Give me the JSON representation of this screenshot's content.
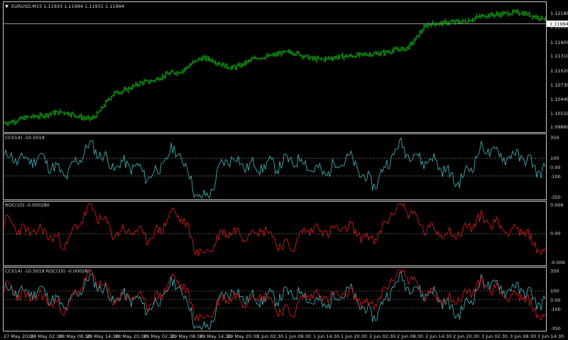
{
  "window": {
    "symbol_header": "EURUSD,M15  1.11933 1.11994 1.11931 1.11994",
    "dropdown_glyph": "▼"
  },
  "colors": {
    "background": "#000000",
    "frame": "#c8c8c8",
    "price_bars": "#16c616",
    "cci_line": "#3fa9b0",
    "roc_line": "#d11a1a",
    "level_line": "#9a9a9a",
    "price_tag_bg": "#ffffff"
  },
  "panes": {
    "price": {
      "current_price_label": "1.11994",
      "y_ticks": [
        "1.12180",
        "1.11890",
        "1.11600",
        "1.11310",
        "1.11020",
        "1.10730",
        "1.10440",
        "1.10150",
        "1.09860"
      ]
    },
    "cci": {
      "label": "CCI(14) -10.5019",
      "y_ticks": [
        "350",
        "100",
        "0.00",
        "-100",
        "-350"
      ]
    },
    "roc": {
      "label": "ROC(10) -0.000280",
      "y_ticks": [
        "0.006",
        "0.00",
        "-0.006"
      ]
    },
    "combo": {
      "label": "CCI(14) -10.5019  ROC(10) -0.000280",
      "y_ticks": [
        "350",
        "100",
        "0.00",
        "-100",
        "-350"
      ]
    }
  },
  "time_axis": [
    "27 May 2020",
    "28 May 02:30",
    "28 May 08:30",
    "28 May 14:30",
    "28 May 20:30",
    "29 May 02:30",
    "29 May 08:30",
    "29 May 14:30",
    "29 May 20:30",
    "1 Jun 02:30",
    "1 Jun 08:30",
    "1 Jun 14:30",
    "1 Jun 20:30",
    "2 Jun 02:30",
    "2 Jun 08:30",
    "2 Jun 14:30",
    "2 Jun 20:30",
    "3 Jun 02:30",
    "3 Jun 08:30",
    "3 Jun 14:30"
  ],
  "chart_data": [
    {
      "type": "ohlc",
      "title": "EURUSD,M15",
      "ylim": [
        1.0986,
        1.1218
      ],
      "last": 1.11994,
      "x": [
        "27 May 2020",
        "28 May 02:30",
        "28 May 08:30",
        "28 May 14:30",
        "28 May 20:30",
        "29 May 02:30",
        "29 May 08:30",
        "29 May 14:30",
        "29 May 20:30",
        "1 Jun 02:30",
        "1 Jun 08:30",
        "1 Jun 14:30",
        "1 Jun 20:30",
        "2 Jun 02:30",
        "2 Jun 08:30",
        "2 Jun 14:30",
        "2 Jun 20:30",
        "3 Jun 02:30",
        "3 Jun 08:30",
        "3 Jun 14:30"
      ],
      "close": [
        1.0993,
        1.1005,
        1.1014,
        1.1001,
        1.1054,
        1.1074,
        1.1092,
        1.112,
        1.1102,
        1.1122,
        1.1132,
        1.1118,
        1.1124,
        1.1129,
        1.1138,
        1.1188,
        1.1192,
        1.1205,
        1.121,
        1.1199
      ]
    },
    {
      "type": "line",
      "title": "CCI(14)",
      "ylim": [
        -350,
        350
      ],
      "levels": [
        100,
        -100
      ],
      "last": -10.5019,
      "x": [
        "27 May 2020",
        "28 May 02:30",
        "28 May 08:30",
        "28 May 14:30",
        "28 May 20:30",
        "29 May 02:30",
        "29 May 08:30",
        "29 May 14:30",
        "29 May 20:30",
        "1 Jun 02:30",
        "1 Jun 08:30",
        "1 Jun 14:30",
        "1 Jun 20:30",
        "2 Jun 02:30",
        "2 Jun 08:30",
        "2 Jun 14:30",
        "2 Jun 20:30",
        "3 Jun 02:30",
        "3 Jun 08:30",
        "3 Jun 14:30"
      ],
      "values": [
        80,
        120,
        -60,
        190,
        40,
        -80,
        150,
        -340,
        110,
        -20,
        90,
        -40,
        60,
        -150,
        230,
        40,
        -120,
        210,
        100,
        -10
      ]
    },
    {
      "type": "line",
      "title": "ROC(10)",
      "ylim": [
        -0.006,
        0.006
      ],
      "levels": [
        0
      ],
      "last": -0.00028,
      "x": [
        "27 May 2020",
        "28 May 02:30",
        "28 May 08:30",
        "28 May 14:30",
        "28 May 20:30",
        "29 May 02:30",
        "29 May 08:30",
        "29 May 14:30",
        "29 May 20:30",
        "1 Jun 02:30",
        "1 Jun 08:30",
        "1 Jun 14:30",
        "1 Jun 20:30",
        "2 Jun 02:30",
        "2 Jun 08:30",
        "2 Jun 14:30",
        "2 Jun 20:30",
        "3 Jun 02:30",
        "3 Jun 08:30",
        "3 Jun 14:30"
      ],
      "values": [
        0.0018,
        0.0008,
        -0.0016,
        0.0042,
        0.0006,
        -0.0004,
        0.0036,
        -0.0036,
        0.0006,
        0.0004,
        -0.0022,
        0.0012,
        0.0006,
        -0.0006,
        0.0058,
        0.0002,
        0.0006,
        0.0028,
        0.0004,
        -0.0028
      ]
    }
  ]
}
